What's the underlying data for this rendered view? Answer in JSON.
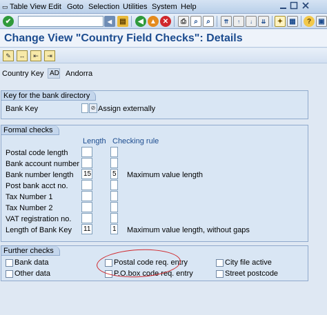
{
  "menu": [
    "Table View",
    "Edit",
    "Goto",
    "Selection",
    "Utilities",
    "System",
    "Help"
  ],
  "title": "Change View \"Country Field Checks\": Details",
  "country": {
    "label": "Country Key",
    "code": "AD",
    "name": "Andorra"
  },
  "bank_directory": {
    "header": "Key for the bank directory",
    "bank_key_label": "Bank Key",
    "bank_key_value": "Assign externally"
  },
  "formal_checks": {
    "header": "Formal checks",
    "length_header": "Length",
    "rule_header": "Checking rule",
    "rows": [
      {
        "label": "Postal code length",
        "length": "",
        "rule": "",
        "desc": ""
      },
      {
        "label": "Bank account number",
        "length": "",
        "rule": "",
        "desc": ""
      },
      {
        "label": "Bank number length",
        "length": "15",
        "rule": "5",
        "desc": "Maximum value length"
      },
      {
        "label": "Post bank acct no.",
        "length": "",
        "rule": "",
        "desc": ""
      },
      {
        "label": "Tax Number 1",
        "length": "",
        "rule": "",
        "desc": ""
      },
      {
        "label": "Tax Number 2",
        "length": "",
        "rule": "",
        "desc": ""
      },
      {
        "label": "VAT registration no.",
        "length": "",
        "rule": "",
        "desc": ""
      },
      {
        "label": "Length of Bank Key",
        "length": "11",
        "rule": "1",
        "desc": "Maximum value length, without gaps"
      }
    ]
  },
  "further_checks": {
    "header": "Further checks",
    "items": [
      "Bank data",
      "Postal code req. entry",
      "City file active",
      "Other data",
      "P.O.box code req. entry",
      "Street postcode"
    ]
  },
  "annotation_color": "#d0262b",
  "accent_color": "#1c4c8f"
}
